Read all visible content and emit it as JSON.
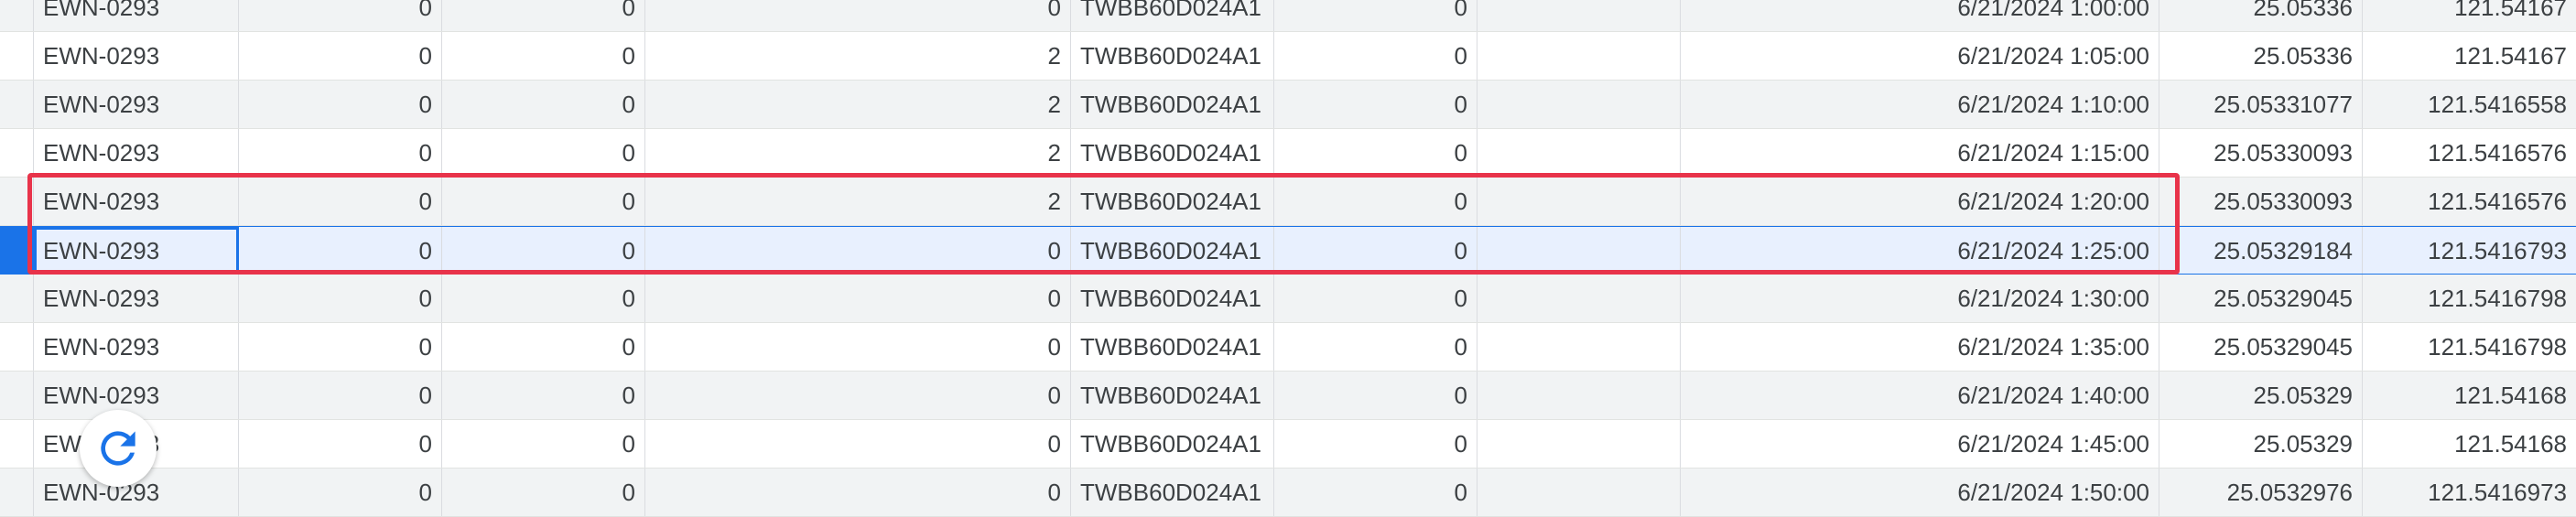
{
  "sheet": {
    "rows": [
      {
        "c": [
          "EWN-0293",
          "0",
          "0",
          "0",
          "TWBB60D024A1",
          "0",
          "",
          "6/21/2024 1:00:00",
          "25.05336",
          "121.54167"
        ]
      },
      {
        "c": [
          "EWN-0293",
          "0",
          "0",
          "2",
          "TWBB60D024A1",
          "0",
          "",
          "6/21/2024 1:05:00",
          "25.05336",
          "121.54167"
        ]
      },
      {
        "c": [
          "EWN-0293",
          "0",
          "0",
          "2",
          "TWBB60D024A1",
          "0",
          "",
          "6/21/2024 1:10:00",
          "25.05331077",
          "121.5416558"
        ]
      },
      {
        "c": [
          "EWN-0293",
          "0",
          "0",
          "2",
          "TWBB60D024A1",
          "0",
          "",
          "6/21/2024 1:15:00",
          "25.05330093",
          "121.5416576"
        ]
      },
      {
        "c": [
          "EWN-0293",
          "0",
          "0",
          "2",
          "TWBB60D024A1",
          "0",
          "",
          "6/21/2024 1:20:00",
          "25.05330093",
          "121.5416576"
        ]
      },
      {
        "c": [
          "EWN-0293",
          "0",
          "0",
          "0",
          "TWBB60D024A1",
          "0",
          "",
          "6/21/2024 1:25:00",
          "25.05329184",
          "121.5416793"
        ]
      },
      {
        "c": [
          "EWN-0293",
          "0",
          "0",
          "0",
          "TWBB60D024A1",
          "0",
          "",
          "6/21/2024 1:30:00",
          "25.05329045",
          "121.5416798"
        ]
      },
      {
        "c": [
          "EWN-0293",
          "0",
          "0",
          "0",
          "TWBB60D024A1",
          "0",
          "",
          "6/21/2024 1:35:00",
          "25.05329045",
          "121.5416798"
        ]
      },
      {
        "c": [
          "EWN-0293",
          "0",
          "0",
          "0",
          "TWBB60D024A1",
          "0",
          "",
          "6/21/2024 1:40:00",
          "25.05329",
          "121.54168"
        ]
      },
      {
        "c": [
          "EWN-0293",
          "0",
          "0",
          "0",
          "TWBB60D024A1",
          "0",
          "",
          "6/21/2024 1:45:00",
          "25.05329",
          "121.54168"
        ]
      },
      {
        "c": [
          "EWN-0293",
          "0",
          "0",
          "0",
          "TWBB60D024A1",
          "0",
          "",
          "6/21/2024 1:50:00",
          "25.0532976",
          "121.5416973"
        ]
      }
    ],
    "selected_row_index": 5,
    "highlighted_rows": [
      4,
      5
    ]
  },
  "colors": {
    "selection": "#1a73e8",
    "highlight_box": "#e8334a",
    "stripe": "#f1f3f4"
  },
  "floating_button": {
    "icon": "refresh-icon"
  }
}
